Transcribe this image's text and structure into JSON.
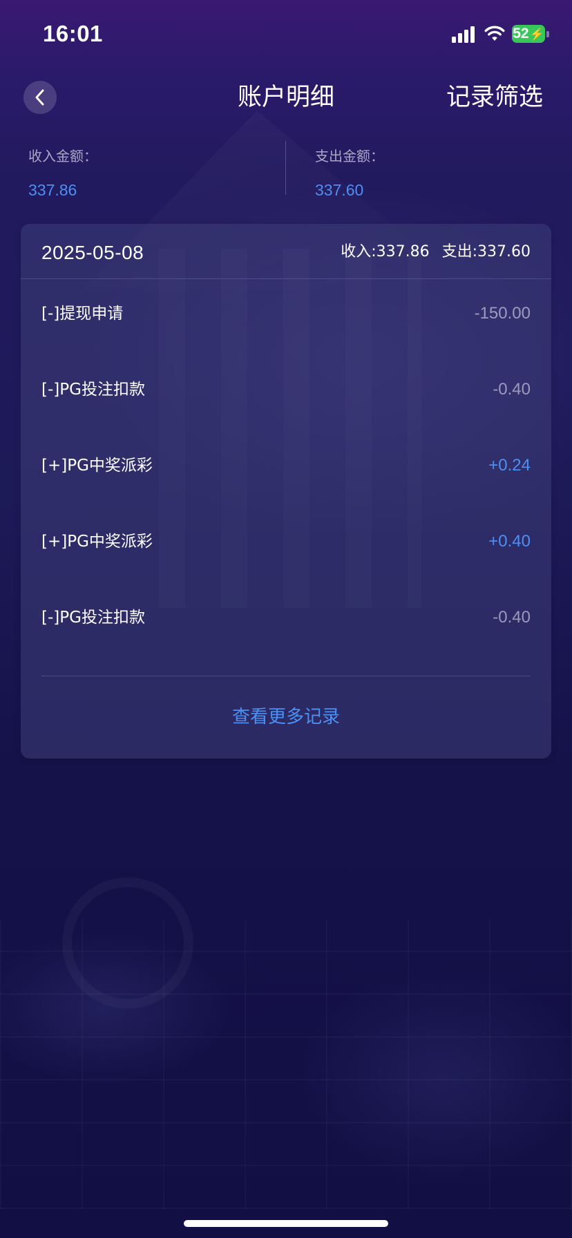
{
  "status_bar": {
    "time": "16:01",
    "battery_level": "52",
    "icons": [
      "signal-icon",
      "wifi-icon",
      "battery-charging-icon"
    ],
    "battery_color": "#38c759"
  },
  "nav": {
    "back_icon": "chevron-left-icon",
    "title": "账户明细",
    "filter_label": "记录筛选"
  },
  "summary": {
    "income_label": "收入金额：",
    "income_value": "337.86",
    "expense_label": "支出金额：",
    "expense_value": "337.60"
  },
  "card": {
    "date": "2025-05-08",
    "income_total": "收入:337.86",
    "expense_total": "支出:337.60",
    "transactions": [
      {
        "name": "[-]提现申请",
        "amount": "-150.00",
        "type": "negative"
      },
      {
        "name": "[-]PG投注扣款",
        "amount": "-0.40",
        "type": "negative"
      },
      {
        "name": "[+]PG中奖派彩",
        "amount": "+0.24",
        "type": "positive"
      },
      {
        "name": "[+]PG中奖派彩",
        "amount": "+0.40",
        "type": "positive"
      },
      {
        "name": "[-]PG投注扣款",
        "amount": "-0.40",
        "type": "negative"
      }
    ],
    "more_label": "查看更多记录"
  },
  "colors": {
    "accent": "#4d8ff2",
    "negative_amount": "#c8c8e1",
    "background_top": "#3a1972",
    "background_bottom": "#120f44"
  }
}
